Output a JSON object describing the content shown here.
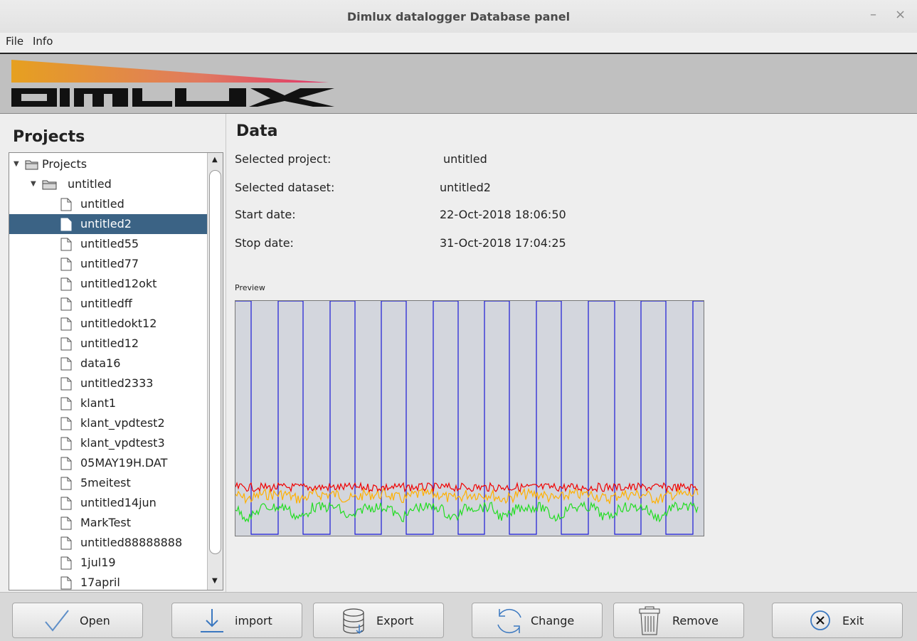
{
  "window": {
    "title": "Dimlux datalogger Database panel",
    "minimize_glyph": "–",
    "close_glyph": "×"
  },
  "menu": {
    "file": "File",
    "info": "Info"
  },
  "banner": {
    "logo_name": "dimlux-logo"
  },
  "projects_panel": {
    "heading": "Projects",
    "root": "Projects",
    "project": "untitled",
    "datasets": [
      "untitled",
      "untitled2",
      "untitled55",
      "untitled77",
      "untitled12okt",
      "untitledff",
      "untitledokt12",
      "untitled12",
      "data16",
      "untitled2333",
      "klant1",
      "klant_vpdtest2",
      "klant_vpdtest3",
      "05MAY19H.DAT",
      "5meitest",
      "untitled14jun",
      "MarkTest",
      "untitled88888888",
      "1jul19",
      "17april"
    ],
    "selected_index": 1
  },
  "data_panel": {
    "heading": "Data",
    "selected_project_label": "Selected project:",
    "selected_project_value": "untitled",
    "selected_dataset_label": "Selected dataset:",
    "selected_dataset_value": "untitled2",
    "start_date_label": "Start date:",
    "start_date_value": "22-Oct-2018 18:06:50",
    "stop_date_label": "Stop date:",
    "stop_date_value": "31-Oct-2018 17:04:25",
    "preview_label": "Preview"
  },
  "chart_data": {
    "type": "line",
    "background": "#d3d6dd",
    "grid": false,
    "colors": {
      "blue": "#1a1ad6",
      "red": "#f00000",
      "orange": "#ffb000",
      "green": "#22dd22"
    }
  },
  "buttons": {
    "open": "Open",
    "import": "import",
    "export": "Export",
    "change": "Change",
    "remove": "Remove",
    "exit": "Exit"
  }
}
